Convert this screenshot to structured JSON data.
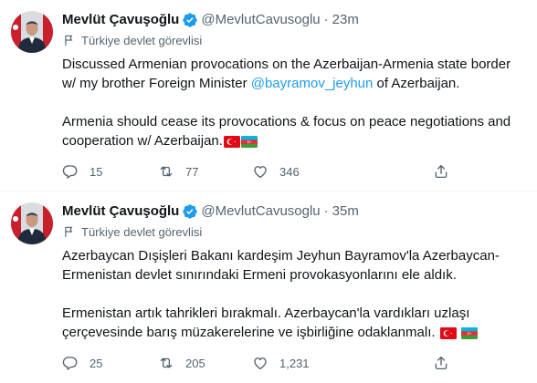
{
  "colors": {
    "accent": "#1d9bf0",
    "secondary_text": "#536471",
    "turkey_red": "#e30a17",
    "az_blue": "#00b5e2",
    "az_green": "#3f9c35"
  },
  "tweets": [
    {
      "name": "Mevlüt Çavuşoğlu",
      "handle": "@MevlutCavusoglu",
      "separator": "·",
      "time": "23m",
      "label": "Türkiye devlet görevlisi",
      "line1_before": "Discussed Armenian provocations on the Azerbaijan-Armenia state border",
      "line2_before": "w/ my brother Foreign Minister ",
      "mention": "@bayramov_jeyhun",
      "line2_after": " of Azerbaijan.",
      "para2_line1": "Armenia should cease its provocations & focus on peace negotiations and",
      "para2_line2": "cooperation w/ Azerbaijan.",
      "reply_count": "15",
      "retweet_count": "77",
      "like_count": "346"
    },
    {
      "name": "Mevlüt Çavuşoğlu",
      "handle": "@MevlutCavusoglu",
      "separator": "·",
      "time": "35m",
      "label": "Türkiye devlet görevlisi",
      "line1": "Azerbaycan Dışişleri Bakanı kardeşim Jeyhun Bayramov'la Azerbaycan-",
      "line2": "Ermenistan devlet sınırındaki Ermeni provokasyonlarını ele aldık.",
      "para2_line1": "Ermenistan artık tahrikleri bırakmalı. Azerbaycan'la vardıkları uzlaşı",
      "para2_line2": "çerçevesinde barış müzakerelerine ve işbirliğine odaklanmalı.",
      "reply_count": "25",
      "retweet_count": "205",
      "like_count": "1,231"
    }
  ],
  "icons": {
    "avatar": "avatar-portrait",
    "verified": "verified-badge-icon",
    "label": "flag-outline-icon",
    "reply": "reply-icon",
    "retweet": "retweet-icon",
    "like": "heart-icon",
    "share": "share-icon",
    "flag_tr": "turkey-flag-emoji",
    "flag_az": "azerbaijan-flag-emoji"
  }
}
